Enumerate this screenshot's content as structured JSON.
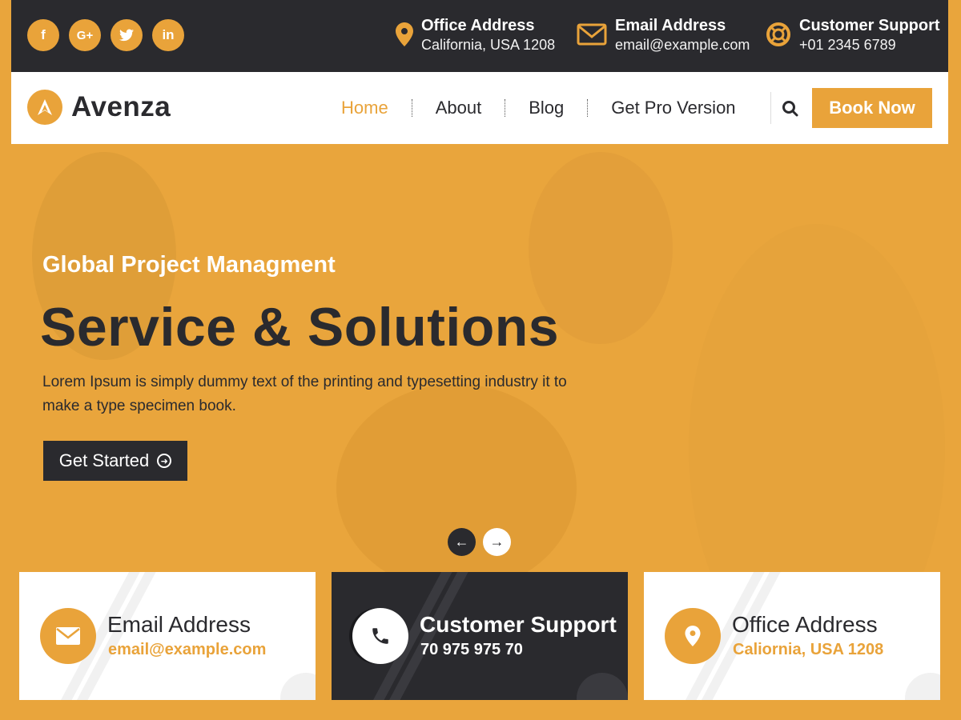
{
  "topbar": {
    "social": [
      {
        "icon": "facebook-icon",
        "glyph": "f"
      },
      {
        "icon": "google-plus-icon",
        "glyph": "G+"
      },
      {
        "icon": "twitter-icon",
        "glyph": "t"
      },
      {
        "icon": "linkedin-icon",
        "glyph": "in"
      }
    ],
    "contacts": [
      {
        "icon": "map-pin-icon",
        "title": "Office Address",
        "value": "California, USA 1208"
      },
      {
        "icon": "envelope-icon",
        "title": "Email Address",
        "value": "email@example.com"
      },
      {
        "icon": "lifebuoy-icon",
        "title": "Customer Support",
        "value": "+01 2345 6789"
      }
    ]
  },
  "navbar": {
    "logo_text": "Avenza",
    "menu": [
      "Home",
      "About",
      "Blog",
      "Get Pro Version"
    ],
    "active_menu": "Home",
    "book_label": "Book Now"
  },
  "hero": {
    "subtitle": "Global Project Managment",
    "title": "Service & Solutions",
    "description": "Lorem Ipsum is simply dummy text of the printing and typesetting industry it to make a type specimen book.",
    "cta_label": "Get Started"
  },
  "cards": [
    {
      "icon": "envelope-icon",
      "title": "Email Address",
      "value": "email@example.com",
      "style": "light"
    },
    {
      "icon": "phone-icon",
      "title": "Customer Support",
      "value": "70 975 975 70",
      "style": "dark"
    },
    {
      "icon": "map-pin-icon",
      "title": "Office Address",
      "value": "Caliornia, USA 1208",
      "style": "light"
    }
  ],
  "colors": {
    "accent": "#e9a33a",
    "dark": "#2a2a2e",
    "white": "#ffffff"
  }
}
